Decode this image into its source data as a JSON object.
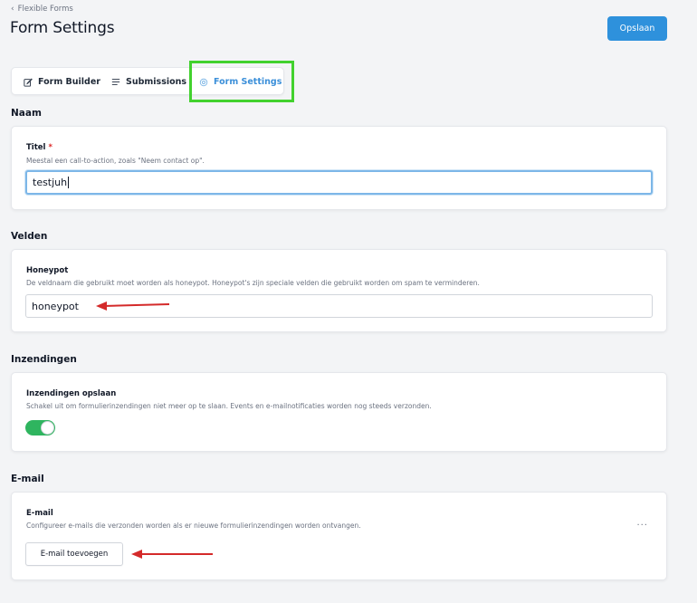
{
  "breadcrumb": {
    "label": "Flexible Forms"
  },
  "page_title": "Form Settings",
  "header": {
    "save_label": "Opslaan"
  },
  "tabs": [
    {
      "label": "Form Builder",
      "icon": "edit-icon",
      "active": false
    },
    {
      "label": "Submissions",
      "icon": "list-icon",
      "active": false
    },
    {
      "label": "Form Settings",
      "icon": "gear-icon",
      "active": true
    }
  ],
  "sections": {
    "naam": {
      "heading": "Naam",
      "field_label": "Titel",
      "required_mark": "*",
      "help": "Meestal een call-to-action, zoals \"Neem contact op\".",
      "value": "testjuh"
    },
    "velden": {
      "heading": "Velden",
      "field_label": "Honeypot",
      "help": "De veldnaam die gebruikt moet worden als honeypot. Honeypot's zijn speciale velden die gebruikt worden om spam te verminderen.",
      "value": "honeypot"
    },
    "inzendingen": {
      "heading": "Inzendingen",
      "field_label": "Inzendingen opslaan",
      "help": "Schakel uit om formulierinzendingen niet meer op te slaan. Events en e-mailnotificaties worden nog steeds verzonden.",
      "toggle_on": true
    },
    "email": {
      "heading": "E-mail",
      "field_label": "E-mail",
      "help": "Configureer e-mails die verzonden worden als er nieuwe formulierinzendingen worden ontvangen.",
      "add_button_label": "E-mail toevoegen",
      "more_label": "···"
    }
  },
  "colors": {
    "primary": "#2e91dc",
    "active_tab": "#3b8fd9",
    "highlight": "#42d12e",
    "annotation_arrow": "#d42a2a",
    "toggle_on": "#2fb55f"
  }
}
